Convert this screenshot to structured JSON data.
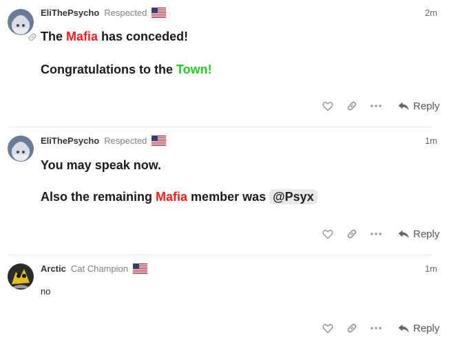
{
  "posts": [
    {
      "username": "EliThePsycho",
      "user_title": "Respected",
      "age": "2m",
      "line1": [
        "The ",
        "Mafia",
        " has conceded!"
      ],
      "line2": [
        "Congratulations to the ",
        "Town!"
      ],
      "reply_label": "Reply"
    },
    {
      "username": "EliThePsycho",
      "user_title": "Respected",
      "age": "1m",
      "line1": "You may speak now.",
      "line2": [
        "Also the remaining ",
        "Mafia",
        " member was ",
        "@Psyx"
      ],
      "reply_label": "Reply"
    },
    {
      "username": "Arctic",
      "user_title": "Cat Champion",
      "age": "1m",
      "text": "no",
      "reply_label": "Reply"
    }
  ],
  "icons": [
    "avatar",
    "us-flag-icon",
    "link-icon",
    "heart-icon",
    "share-link-icon",
    "more-icon",
    "reply-arrow-icon"
  ],
  "colors": {
    "mafia": "#ff1a1a",
    "town": "#1fd11f",
    "meta_gray": "#808080"
  }
}
